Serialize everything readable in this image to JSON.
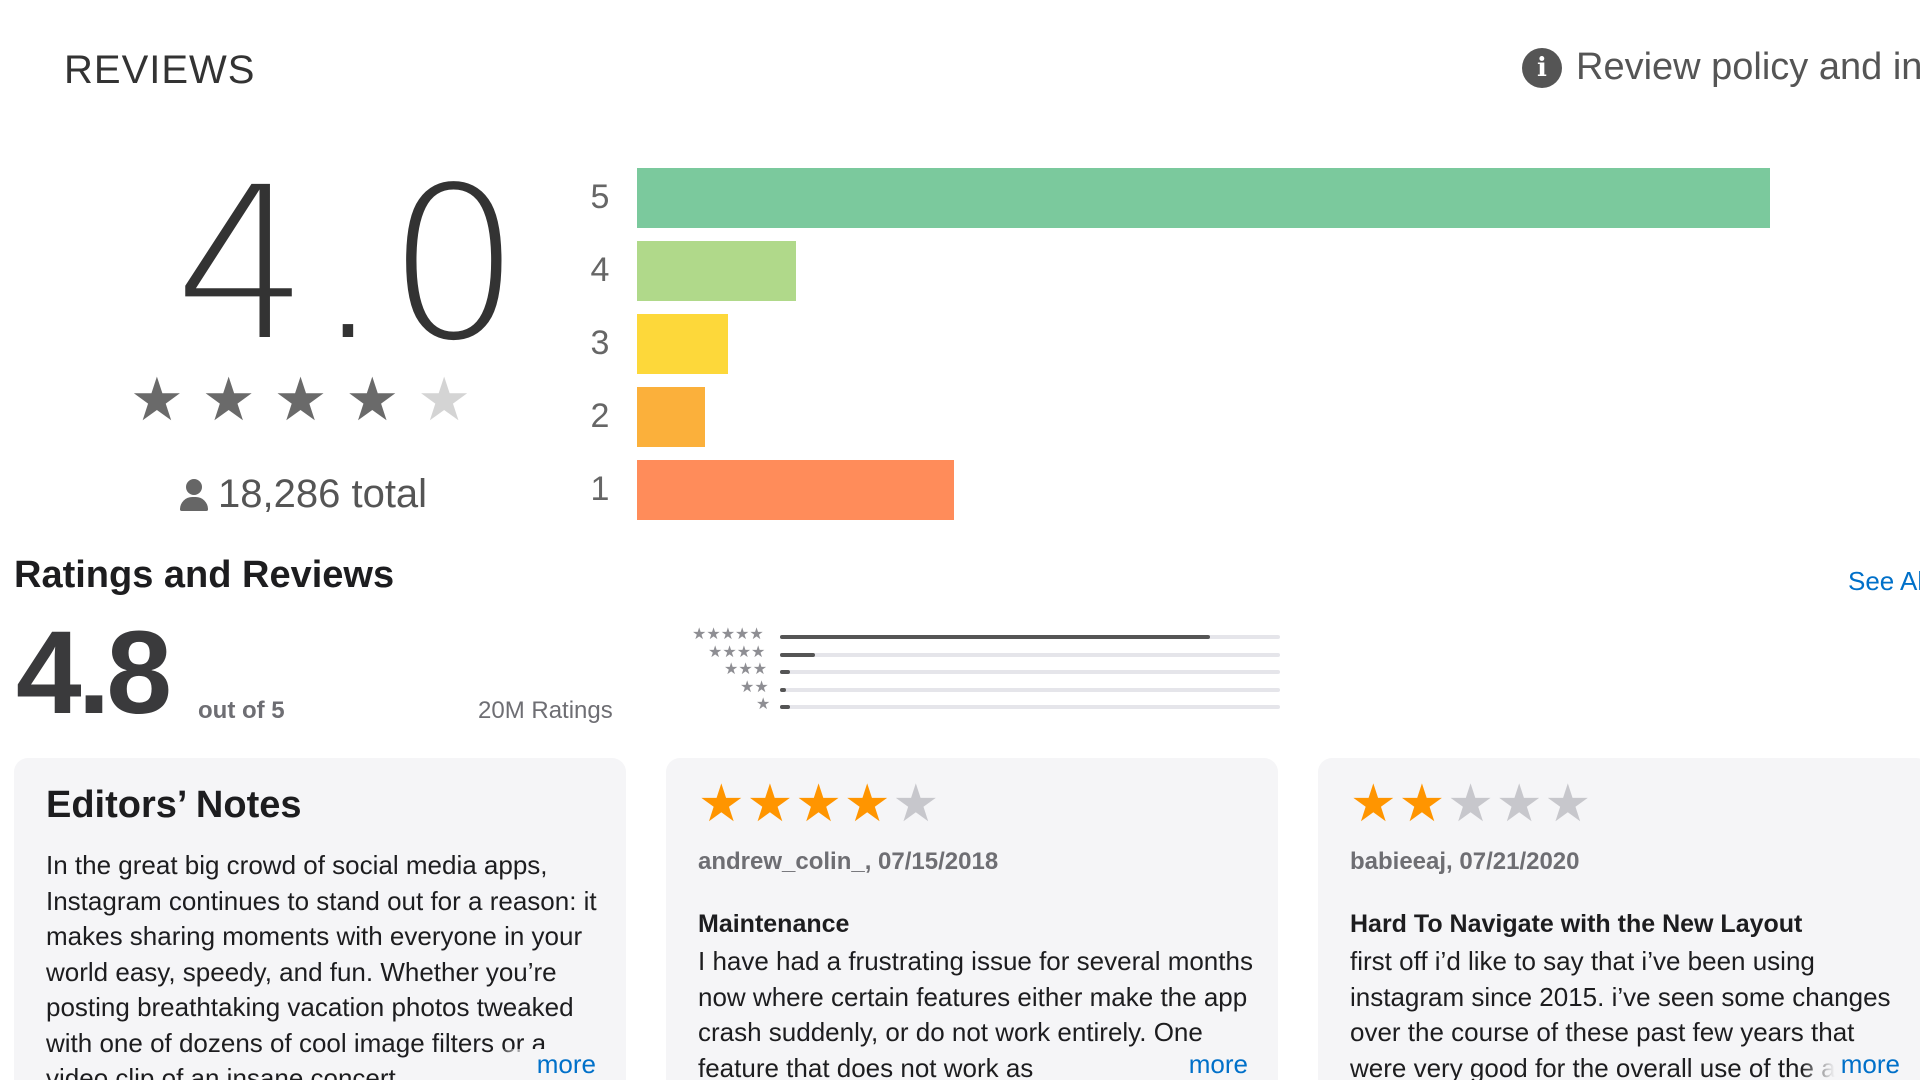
{
  "google_play": {
    "section_title": "REVIEWS",
    "policy_link": "Review policy and info",
    "average_score": "4.0",
    "star_rating": 4,
    "stars_max": 5,
    "total_label": "18,286 total",
    "histogram": [
      {
        "label": "5",
        "fraction": 1.0,
        "color": "#7bc99d"
      },
      {
        "label": "4",
        "fraction": 0.14,
        "color": "#b0d98a"
      },
      {
        "label": "3",
        "fraction": 0.08,
        "color": "#fdd83a"
      },
      {
        "label": "2",
        "fraction": 0.06,
        "color": "#fbb03b"
      },
      {
        "label": "1",
        "fraction": 0.28,
        "color": "#ff8c5a"
      }
    ]
  },
  "app_store": {
    "section_title": "Ratings and Reviews",
    "see_all": "See All",
    "score": "4.8",
    "out_of": "out of 5",
    "ratings_count": "20M Ratings",
    "histogram": [
      {
        "stars": 5,
        "fraction": 0.86
      },
      {
        "stars": 4,
        "fraction": 0.07
      },
      {
        "stars": 3,
        "fraction": 0.02
      },
      {
        "stars": 2,
        "fraction": 0.01
      },
      {
        "stars": 1,
        "fraction": 0.02
      }
    ],
    "editors_notes": {
      "title": "Editors’ Notes",
      "body": "In the great big crowd of social media apps, Instagram continues to stand out for a reason: it makes sharing moments with everyone in your world easy, speedy, and fun. Whether you’re posting breathtaking vacation photos tweaked with one of dozens of cool image filters or a video clip of an insane concert",
      "more": "more"
    },
    "reviews": [
      {
        "rating": 4,
        "meta": "andrew_colin_, 07/15/2018",
        "heading": "Maintenance",
        "body": "I have had a frustrating issue for several months now where certain features either make the app crash suddenly, or do not work entirely. One feature that does not work as",
        "more": "more"
      },
      {
        "rating": 2,
        "meta": "babieeaj, 07/21/2020",
        "heading": "Hard To Navigate with the New Layout",
        "body": "first off i’d like to say that i’ve been using instagram since 2015. i’ve seen some changes over the course of these past few years that were very good for the overall use of the app",
        "more": "more"
      }
    ]
  },
  "colors": {
    "star_gray": "#6a6a6a",
    "star_orange": "#ff9500",
    "link_blue": "#0070c9",
    "card_bg": "#f5f5f7"
  },
  "icons": {
    "info": "info-icon",
    "person": "person-icon",
    "star": "star-icon"
  }
}
